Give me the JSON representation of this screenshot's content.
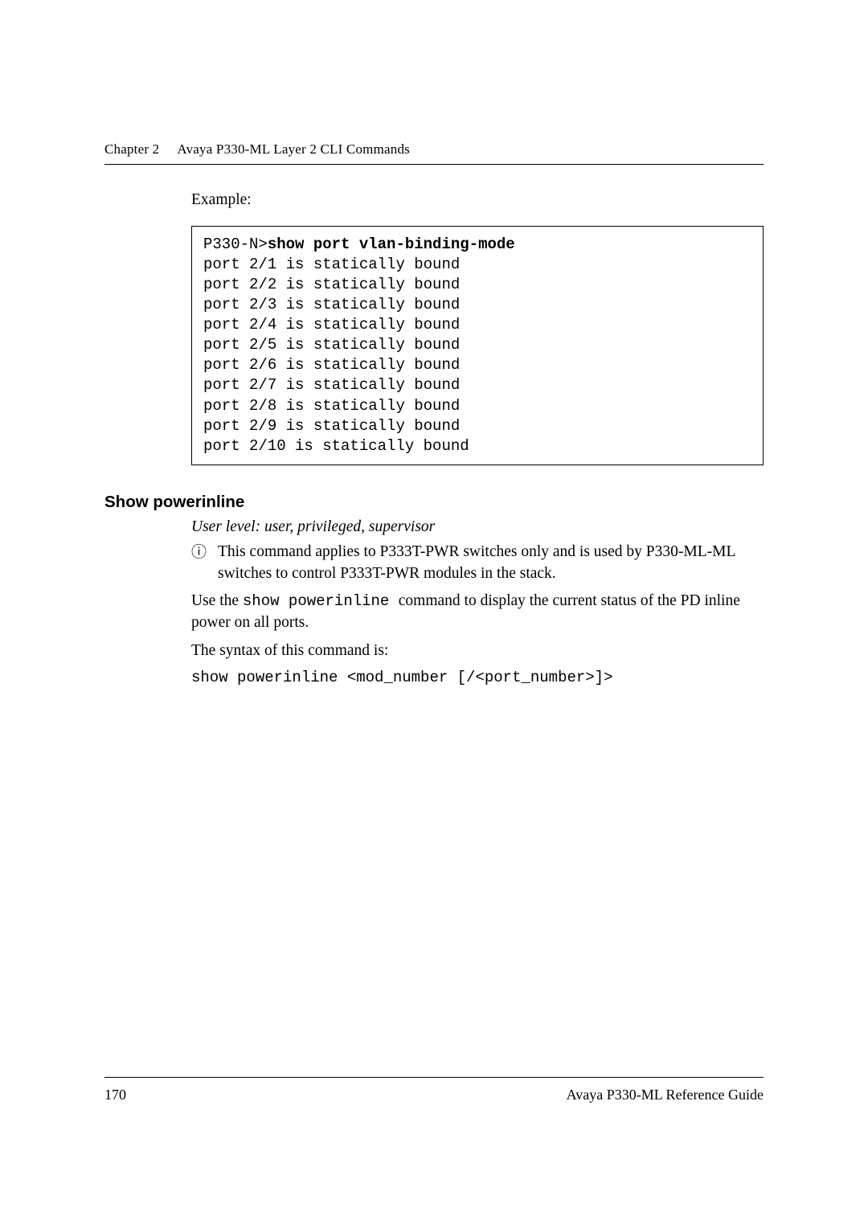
{
  "header": {
    "chapter_label": "Chapter 2",
    "chapter_title": "Avaya P330-ML Layer 2 CLI Commands"
  },
  "example_label": "Example:",
  "command_output": {
    "prompt": "P330-N>",
    "cmd": "show port vlan-binding-mode",
    "lines": [
      "port 2/1 is statically bound",
      "port 2/2 is statically bound",
      "port 2/3 is statically bound",
      "port 2/4 is statically bound",
      "port 2/5 is statically bound",
      "port 2/6 is statically bound",
      "port 2/7 is statically bound",
      "port 2/8 is statically bound",
      "port 2/9 is statically bound",
      "port 2/10 is statically bound"
    ]
  },
  "section": {
    "title": "Show powerinline",
    "user_level": "User level: user, privileged, supervisor",
    "note_icon": "ⓘ",
    "note_text": "This command applies to P333T-PWR switches only and is used by P330-ML-ML switches to control P333T-PWR modules in the stack.",
    "use_prefix": "Use the ",
    "use_code": "show powerinline ",
    "use_suffix": "command to display the current status of the PD inline power on all ports.",
    "syntax_intro": "The syntax of this command is:",
    "syntax_line": "show powerinline <mod_number [/<port_number>]>"
  },
  "footer": {
    "page": "170",
    "guide": "Avaya P330-ML Reference Guide"
  }
}
